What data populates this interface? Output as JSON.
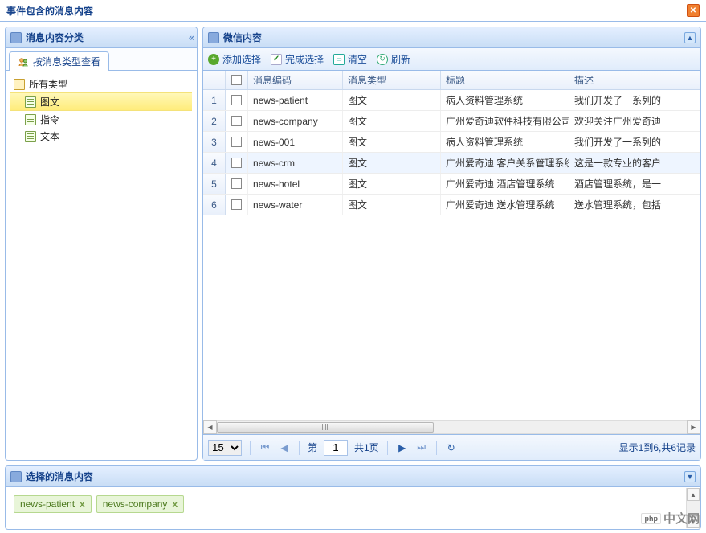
{
  "window": {
    "title": "事件包含的消息内容"
  },
  "left_panel": {
    "title": "消息内容分类",
    "tab_label": "按消息类型查看",
    "tree": {
      "root": "所有类型",
      "items": [
        "图文",
        "指令",
        "文本"
      ],
      "selected_index": 0
    }
  },
  "right_panel": {
    "title": "微信内容",
    "toolbar": {
      "add_label": "添加选择",
      "done_label": "完成选择",
      "clear_label": "清空",
      "refresh_label": "刷新"
    },
    "grid": {
      "headers": {
        "code": "消息编码",
        "type": "消息类型",
        "title": "标题",
        "desc": "描述"
      },
      "rows": [
        {
          "n": "1",
          "code": "news-patient",
          "type": "图文",
          "title": "病人资料管理系统",
          "desc": "我们开发了一系列的"
        },
        {
          "n": "2",
          "code": "news-company",
          "type": "图文",
          "title": "广州爱奇迪软件科技有限公司",
          "desc": "欢迎关注广州爱奇迪"
        },
        {
          "n": "3",
          "code": "news-001",
          "type": "图文",
          "title": "病人资料管理系统",
          "desc": "我们开发了一系列的"
        },
        {
          "n": "4",
          "code": "news-crm",
          "type": "图文",
          "title": "广州爱奇迪 客户关系管理系统",
          "desc": "这是一款专业的客户"
        },
        {
          "n": "5",
          "code": "news-hotel",
          "type": "图文",
          "title": "广州爱奇迪 酒店管理系统",
          "desc": "酒店管理系统，是一"
        },
        {
          "n": "6",
          "code": "news-water",
          "type": "图文",
          "title": "广州爱奇迪 送水管理系统",
          "desc": "送水管理系统，包括"
        }
      ],
      "hover_index": 3
    },
    "pager": {
      "page_size": "15",
      "page_label_prefix": "第",
      "page_value": "1",
      "page_label_suffix": "共1页",
      "display_info": "显示1到6,共6记录"
    }
  },
  "selected_panel": {
    "title": "选择的消息内容",
    "tags": [
      "news-patient",
      "news-company"
    ]
  },
  "watermark": {
    "badge": "php",
    "text": "中文网"
  }
}
